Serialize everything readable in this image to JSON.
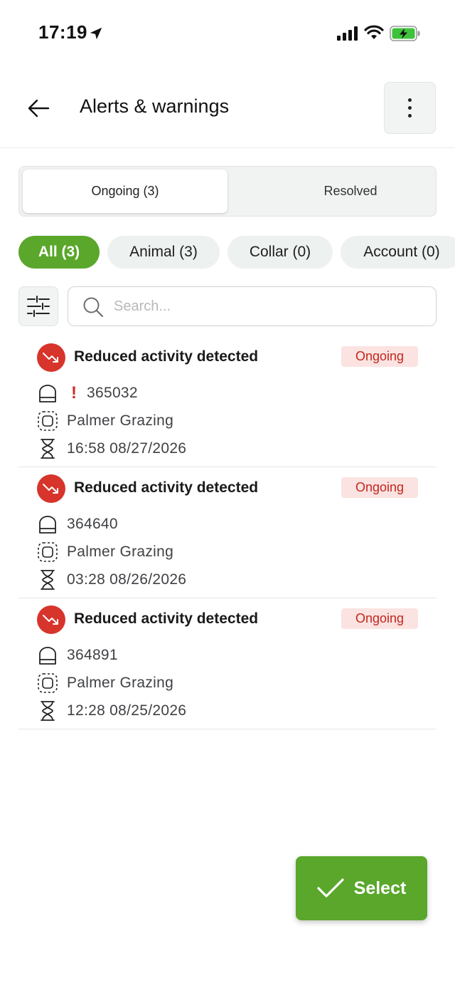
{
  "status_bar": {
    "time": "17:19"
  },
  "header": {
    "title": "Alerts & warnings"
  },
  "tabs": [
    {
      "label": "Ongoing (3)",
      "active": true
    },
    {
      "label": "Resolved",
      "active": false
    }
  ],
  "chips": [
    {
      "label": "All (3)",
      "active": true
    },
    {
      "label": "Animal (3)",
      "active": false
    },
    {
      "label": "Collar (0)",
      "active": false
    },
    {
      "label": "Account (0)",
      "active": false
    }
  ],
  "search": {
    "placeholder": "Search...",
    "value": ""
  },
  "alerts": [
    {
      "title": "Reduced activity detected",
      "status": "Ongoing",
      "animal_id": "365032",
      "flag": "!",
      "herd": "Palmer Grazing",
      "time": "16:58 08/27/2026"
    },
    {
      "title": "Reduced activity detected",
      "status": "Ongoing",
      "animal_id": "364640",
      "flag": "",
      "herd": "Palmer Grazing",
      "time": "03:28 08/26/2026"
    },
    {
      "title": "Reduced activity detected",
      "status": "Ongoing",
      "animal_id": "364891",
      "flag": "",
      "herd": "Palmer Grazing",
      "time": "12:28 08/25/2026"
    }
  ],
  "fab": {
    "label": "Select"
  },
  "colors": {
    "brand_green": "#5aa72b",
    "alert_red": "#d7342b",
    "status_pill_bg": "#fbe3e1",
    "status_pill_text": "#c3261d"
  },
  "icons": {
    "back": "arrow-left-icon",
    "more": "more-vertical-icon",
    "filter": "sliders-icon",
    "search": "search-icon",
    "alert": "trend-down-icon",
    "animal": "collar-icon",
    "herd": "herd-group-icon",
    "time": "hourglass-icon",
    "fab": "checkmark-icon"
  }
}
